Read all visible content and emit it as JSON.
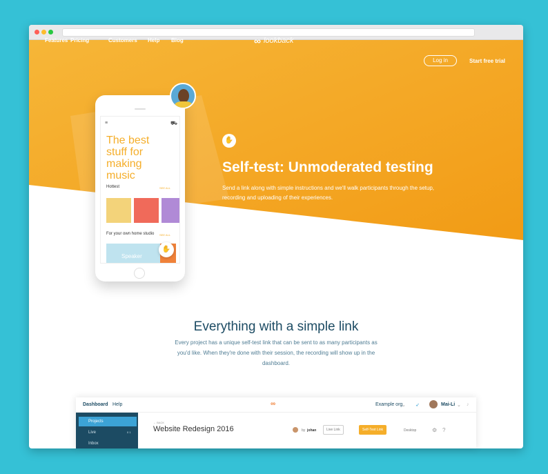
{
  "browser": {
    "dots": [
      "#ff5f57",
      "#febc2e",
      "#28c840"
    ]
  },
  "colors": {
    "accent": "#f5ae2a",
    "accent_dark": "#f29b15",
    "navy": "#1c4b63",
    "backdrop": "#35c1d6"
  },
  "nav": {
    "links": [
      "Features",
      "Pricing",
      "Customers",
      "Help",
      "Blog"
    ],
    "logo_mark": "∞",
    "logo_text": "lookback",
    "login": "Log in",
    "trial": "Start free trial"
  },
  "phone": {
    "headline": "The best stuff for making music",
    "section1": "Hottest",
    "see_all": "SEE ALL",
    "section2": "For your own home studio",
    "card": "Speaker"
  },
  "hero": {
    "title": "Self-test: Unmoderated testing",
    "description": "Send a link along with simple instructions and we'll walk participants through the setup, recording and uploading of their experiences."
  },
  "section": {
    "title": "Everything with a simple link",
    "description": "Every project has a unique self-test link that can be sent to as many participants as you'd like. When they're done with their session, the recording will show up in the dashboard."
  },
  "dashboard": {
    "tabs": [
      "Dashboard",
      "Help"
    ],
    "org": "Example org",
    "user": "Mai-Li",
    "sidebar": [
      {
        "label": "Projects"
      },
      {
        "label": "Live",
        "count": "0 1"
      },
      {
        "label": "Inbox"
      }
    ],
    "back": "← BACK",
    "project_title": "Website Redesign 2016",
    "by": "by",
    "owner": "johan",
    "buttons": [
      "Live Link",
      "Self-Test Link",
      "Desktop"
    ]
  }
}
